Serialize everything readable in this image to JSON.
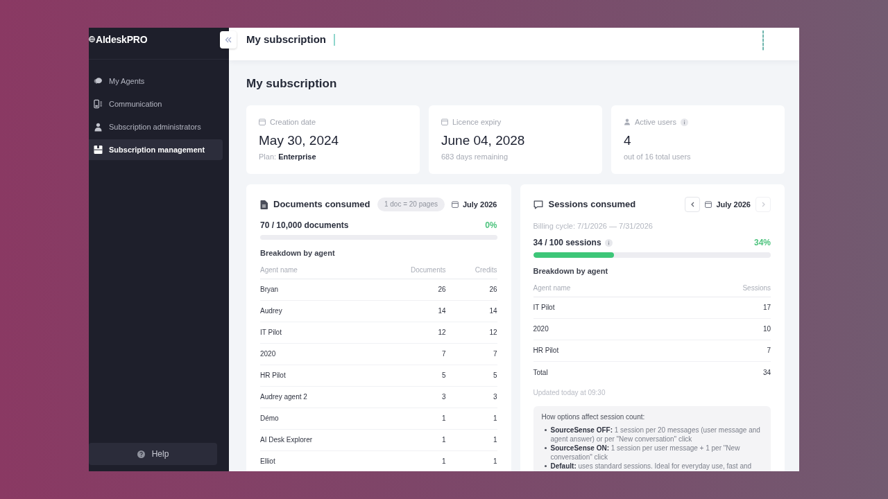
{
  "sidebar": {
    "logo": "AIdeskPRO",
    "items": [
      {
        "label": "My Agents",
        "selected": false
      },
      {
        "label": "Communication",
        "selected": false
      },
      {
        "label": "Subscription administrators",
        "selected": false
      },
      {
        "label": "Subscription management",
        "selected": true
      }
    ],
    "help": "Help"
  },
  "header": {
    "title": "My subscription"
  },
  "page_title": "My subscription",
  "stats": [
    {
      "kind": "date",
      "label": "Creation date",
      "value": "May 30, 2024",
      "note": "Plan: **Enterprise**"
    },
    {
      "kind": "date",
      "label": "Licence expiry",
      "value": "June 04, 2028",
      "note": "683 days remaining"
    },
    {
      "kind": "users",
      "label": "Active users",
      "value": "4",
      "note": "out of 16 total users"
    }
  ],
  "documents": {
    "title": "Documents consumed",
    "badge": "1 doc = 20 pages",
    "month": "July 2026",
    "usage": "70 / 10,000 documents",
    "percent": "0%",
    "level": 0,
    "breakdown": "Breakdown by agent",
    "columns": [
      "Agent name",
      "Documents",
      "Credits"
    ],
    "rows": [
      [
        "Bryan",
        "26",
        "26"
      ],
      [
        "Audrey",
        "14",
        "14"
      ],
      [
        "IT Pilot",
        "12",
        "12"
      ],
      [
        "2020",
        "7",
        "7"
      ],
      [
        "HR Pilot",
        "5",
        "5"
      ],
      [
        "Audrey agent 2",
        "3",
        "3"
      ],
      [
        "Démo",
        "1",
        "1"
      ],
      [
        "AI Desk Explorer",
        "1",
        "1"
      ],
      [
        "Elliot",
        "1",
        "1"
      ]
    ]
  },
  "sessions": {
    "title": "Sessions consumed",
    "prev": {
      "disabled": false
    },
    "month": "July 2026",
    "next": {
      "disabled": true
    },
    "billing_cycle": "Billing cycle: 7/1/2026 — 7/31/2026",
    "usage": "34 / 100 sessions",
    "percent": "34%",
    "level": 0.34,
    "breakdown": "Breakdown by agent",
    "columns": [
      "Agent name",
      "Sessions"
    ],
    "rows": [
      [
        "IT Pilot",
        "17"
      ],
      [
        "2020",
        "10"
      ],
      [
        "HR Pilot",
        "7"
      ]
    ],
    "total": [
      "Total",
      "34"
    ],
    "updated": "Updated today at 09:30",
    "note": {
      "title": "How options affect session count:",
      "items": [
        "**SourceSense OFF:** 1 session per 20 messages (user message and agent answer) or per \"New conversation\" click",
        "**SourceSense ON:** 1 session per user message + 1 per \"New conversation\" click",
        "**Default:** uses standard sessions. Ideal for everyday use, fast and"
      ]
    }
  }
}
